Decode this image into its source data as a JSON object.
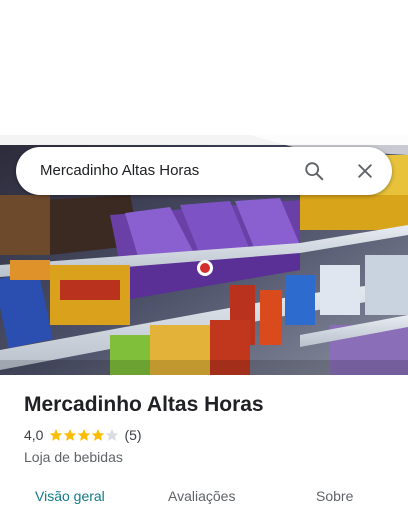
{
  "search": {
    "query": "Mercadinho Altas Horas"
  },
  "icons": {
    "search": "search-icon",
    "close": "close-icon",
    "star": "star-icon"
  },
  "place": {
    "name": "Mercadinho Altas Horas",
    "rating": "4,0",
    "rating_value": 4.0,
    "rating_max": 5,
    "review_count": "(5)",
    "category": "Loja de bebidas"
  },
  "tabs": [
    {
      "label": "Visão geral",
      "active": true
    },
    {
      "label": "Avaliações",
      "active": false
    },
    {
      "label": "Sobre",
      "active": false
    }
  ],
  "colors": {
    "star_filled": "#fbbc04",
    "star_empty": "#dadce0",
    "active_tab": "#137a8a"
  }
}
